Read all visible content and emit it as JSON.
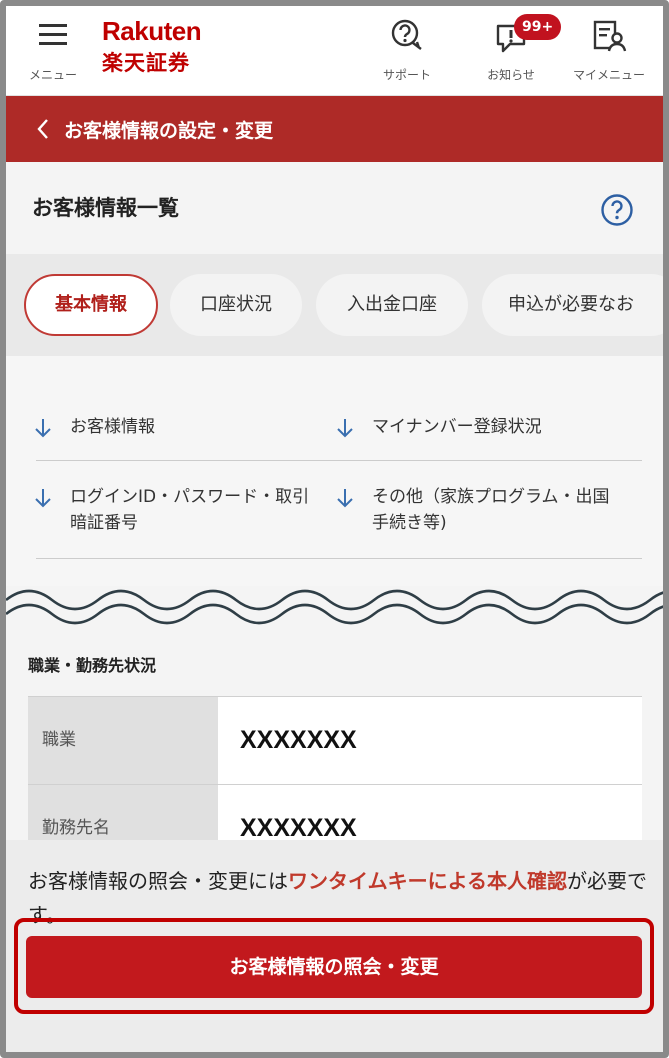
{
  "header": {
    "menu_label": "メニュー",
    "logo_top": "Rakuten",
    "logo_bottom": "楽天証券",
    "support_label": "サポート",
    "notice_label": "お知らせ",
    "notice_badge": "99+",
    "mymenu_label": "マイメニュー"
  },
  "title_bar": {
    "title": "お客様情報の設定・変更"
  },
  "section": {
    "title": "お客様情報一覧"
  },
  "tabs": [
    {
      "label": "基本情報",
      "active": true
    },
    {
      "label": "口座状況",
      "active": false
    },
    {
      "label": "入出金口座",
      "active": false
    },
    {
      "label": "申込が必要なお",
      "active": false
    }
  ],
  "anchors": [
    {
      "lines": [
        "お客様情報"
      ]
    },
    {
      "lines": [
        "マイナンバー登録状況"
      ]
    },
    {
      "lines": [
        "ログインID・パスワード・取引",
        "暗証番号"
      ]
    },
    {
      "lines": [
        "その他（家族プログラム・出国",
        "手続き等)"
      ]
    }
  ],
  "occupation": {
    "title": "職業・勤務先状況",
    "rows": [
      {
        "label": "職業",
        "value": "XXXXXXX"
      },
      {
        "label": "勤務先名",
        "value": "XXXXXXX"
      }
    ]
  },
  "notice": {
    "text_before": "お客様情報の照会・変更には",
    "text_emphasis": "ワンタイムキーによる本人確認",
    "text_after": "が必要です。",
    "button_label": "お客様情報の照会・変更"
  },
  "colors": {
    "brand_red": "#bf0000",
    "title_bar": "#ae2a27",
    "cta": "#c2191d",
    "link_blue": "#3a6fb0"
  }
}
